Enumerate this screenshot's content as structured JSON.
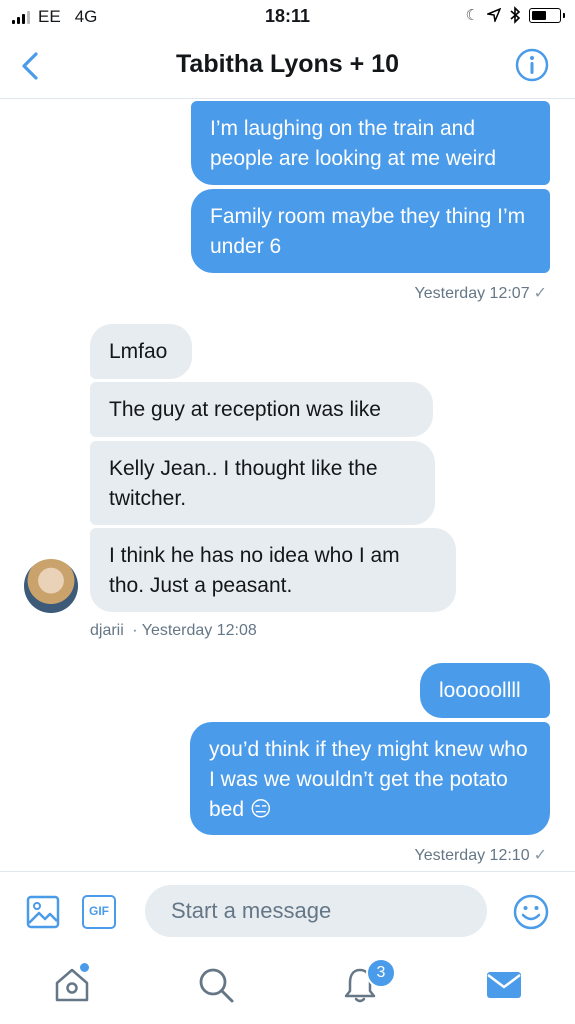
{
  "status_bar": {
    "carrier": "EE",
    "network": "4G",
    "time": "18:11"
  },
  "header": {
    "title": "Tabitha Lyons + 10"
  },
  "messages": {
    "m1": "I’m laughing on the train and people are looking at me weird",
    "m2": "Family room maybe they thing I’m under 6",
    "t1": "Yesterday 12:07",
    "m3": "Lmfao",
    "m4": "The guy at reception was like",
    "m5": "Kelly Jean.. I thought like the twitcher.",
    "m6": "I think he has no idea who I am tho. Just a peasant.",
    "sender": "djarii",
    "t2": "· Yesterday 12:08",
    "m7": "looooollll",
    "m8": "you’d think if they might knew who I was we wouldn’t get the potato bed 😑",
    "t3": "Yesterday 12:10"
  },
  "composer": {
    "placeholder": "Start a message",
    "gif_label": "GIF"
  },
  "tabs": {
    "notifications_badge": "3"
  },
  "colors": {
    "accent": "#4a9be9",
    "incoming_bubble": "#e6ecf0"
  }
}
